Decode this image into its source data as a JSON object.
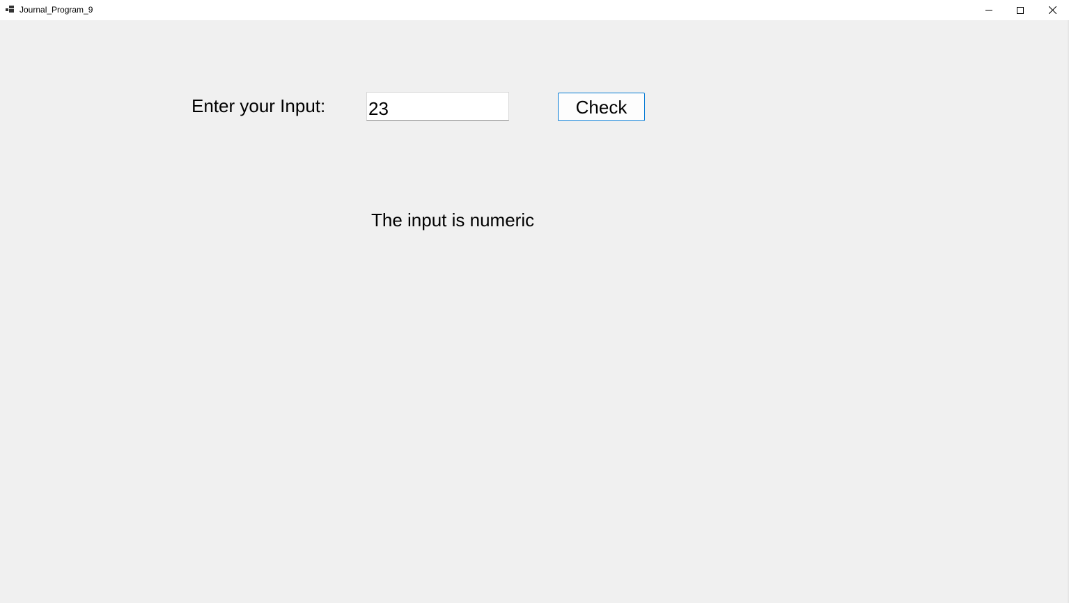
{
  "window": {
    "title": "Journal_Program_9",
    "icon": "app-window-icon",
    "controls": {
      "minimize_icon": "minimize-icon",
      "maximize_icon": "maximize-icon",
      "close_icon": "close-icon"
    }
  },
  "form": {
    "prompt_label": "Enter your Input:",
    "input_value": "23",
    "check_button_label": "Check",
    "result_text": "The input is numeric"
  },
  "colors": {
    "background": "#f0f0f0",
    "titlebar": "#ffffff",
    "button_border": "#0078d4"
  }
}
